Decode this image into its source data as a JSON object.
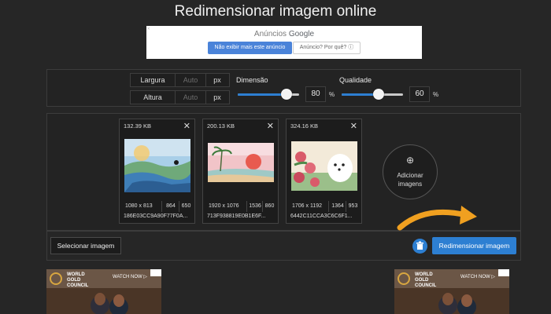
{
  "page": {
    "title": "Redimensionar imagem online"
  },
  "ad_top": {
    "label_prefix": "Anúncios ",
    "label_brand": "Google",
    "stop_button": "Não exibir mais este anúncio",
    "why_button": "Anúncio? Por quê? ⓘ",
    "corner": "‹"
  },
  "settings": {
    "width_label": "Largura",
    "width_placeholder": "Auto",
    "width_unit": "px",
    "height_label": "Altura",
    "height_placeholder": "Auto",
    "height_unit": "px",
    "dimension_label": "Dimensão",
    "dimension_value": "80",
    "dimension_level": 0.8,
    "dimension_unit": "%",
    "quality_label": "Qualidade",
    "quality_value": "60",
    "quality_level": 0.6,
    "quality_unit": "%"
  },
  "images": [
    {
      "size": "132.39 KB",
      "width": "1080 x 813",
      "new_w": "864",
      "new_h": "650",
      "file": "186E03CC9A90F77F0A..."
    },
    {
      "size": "200.13 KB",
      "width": "1920 x 1076",
      "new_w": "1536",
      "new_h": "860",
      "file": "713F938819E0B1E6F..."
    },
    {
      "size": "324.16 KB",
      "width": "1706 x 1192",
      "new_w": "1364",
      "new_h": "953",
      "file": "6442C11CCA3C6C6F1..."
    }
  ],
  "add_images": {
    "plus": "⊕",
    "label_line1": "Adicionar",
    "label_line2": "imagens"
  },
  "actions": {
    "select_button": "Selecionar imagem",
    "resize_button": "Redimensionar imagem",
    "accent": "#2d7fd2"
  },
  "ads_bottom": {
    "brand_line1": "WORLD",
    "brand_line2": "GOLD",
    "brand_line3": "COUNCIL",
    "cta": "WATCH NOW ▷"
  },
  "close_glyph": "✕"
}
